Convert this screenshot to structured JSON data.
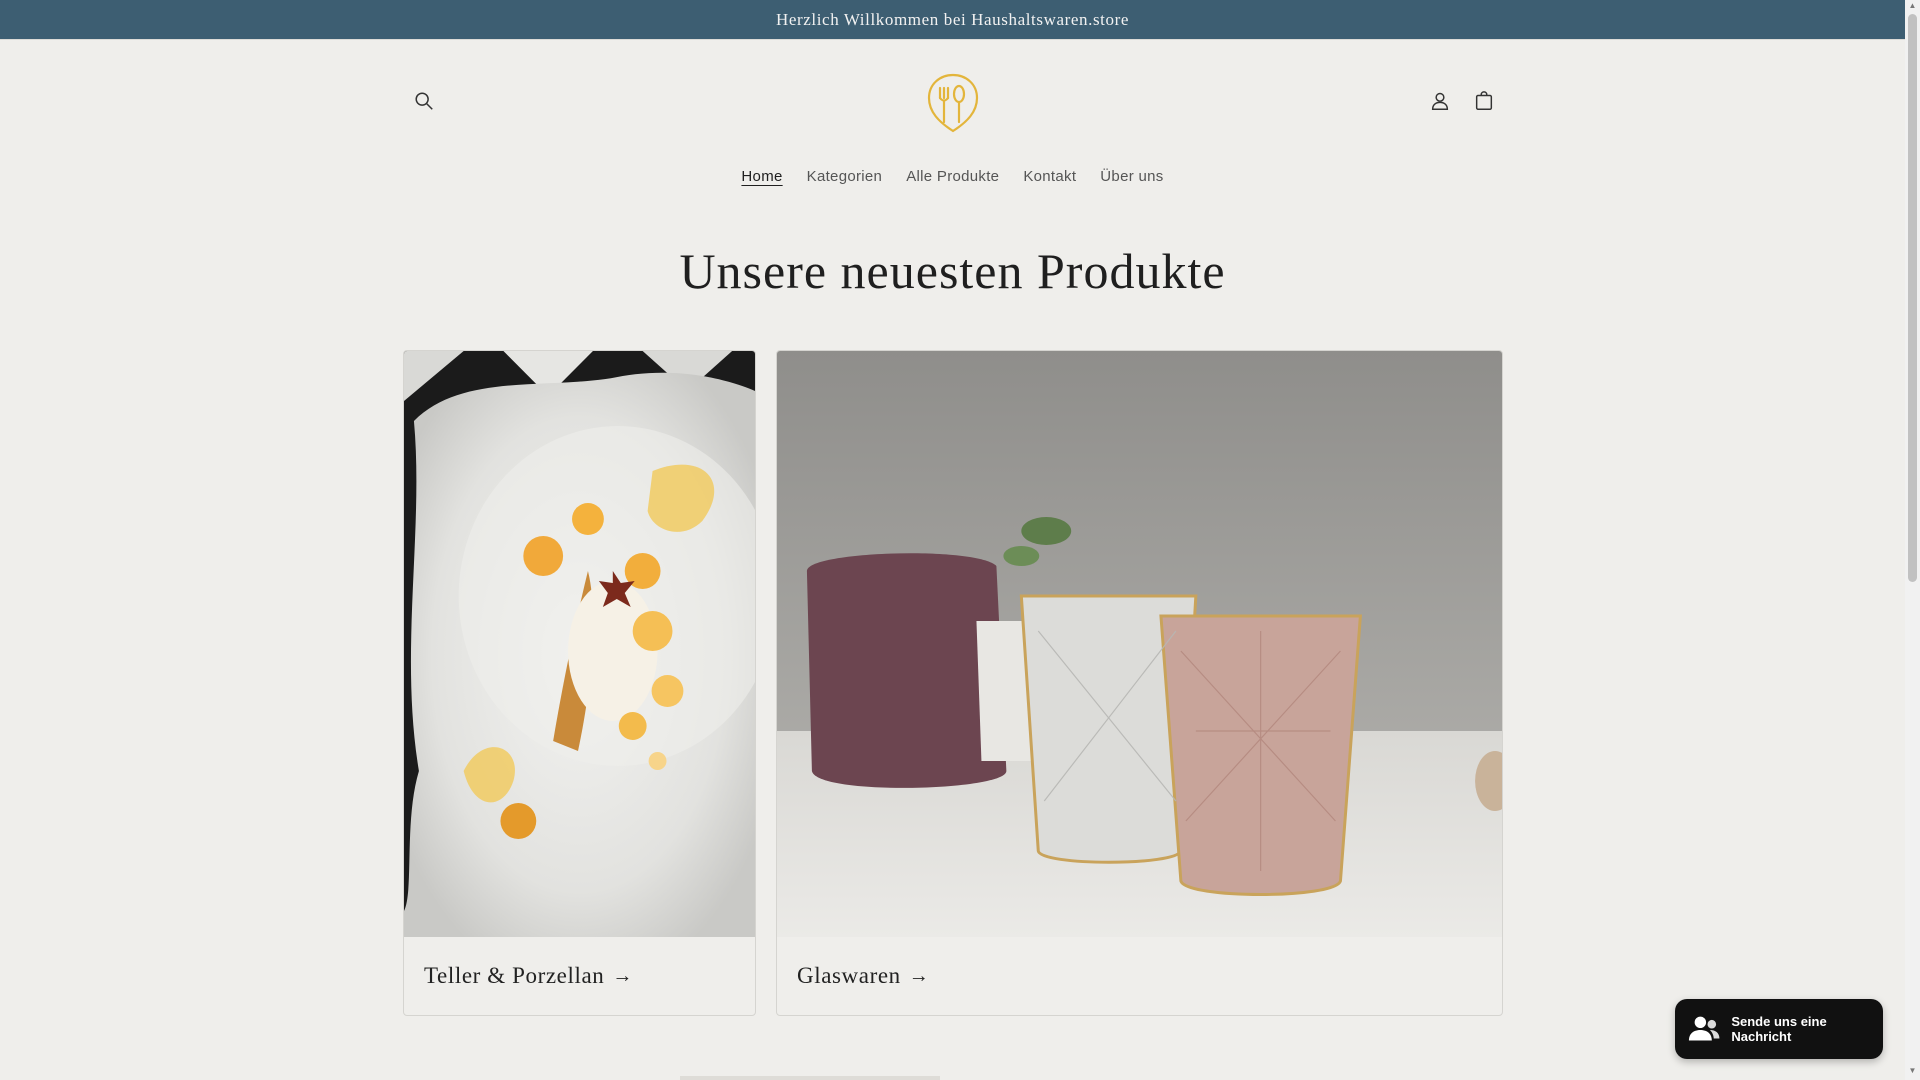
{
  "announcement": {
    "text": "Herzlich Willkommen bei Haushaltswaren.store"
  },
  "header": {
    "search_icon": "search-icon",
    "logo_icon": "cutlery-logo",
    "account_icon": "user-icon",
    "cart_icon": "cart-icon"
  },
  "nav": {
    "items": [
      {
        "label": "Home",
        "active": true
      },
      {
        "label": "Kategorien",
        "active": false
      },
      {
        "label": "Alle Produkte",
        "active": false
      },
      {
        "label": "Kontakt",
        "active": false
      },
      {
        "label": "Über uns",
        "active": false
      }
    ]
  },
  "section": {
    "title": "Unsere neuesten Produkte"
  },
  "collections": [
    {
      "label": "Teller & Porzellan",
      "arrow": "→"
    },
    {
      "label": "Glaswaren",
      "arrow": "→"
    }
  ],
  "chat": {
    "label": "Sende uns eine Nachricht",
    "icon": "chat-user-icon"
  },
  "colors": {
    "announcement_bg": "#3d5e72",
    "page_bg": "#efeeeb",
    "logo_gold": "#e3b53b",
    "chat_bg": "#111111"
  }
}
